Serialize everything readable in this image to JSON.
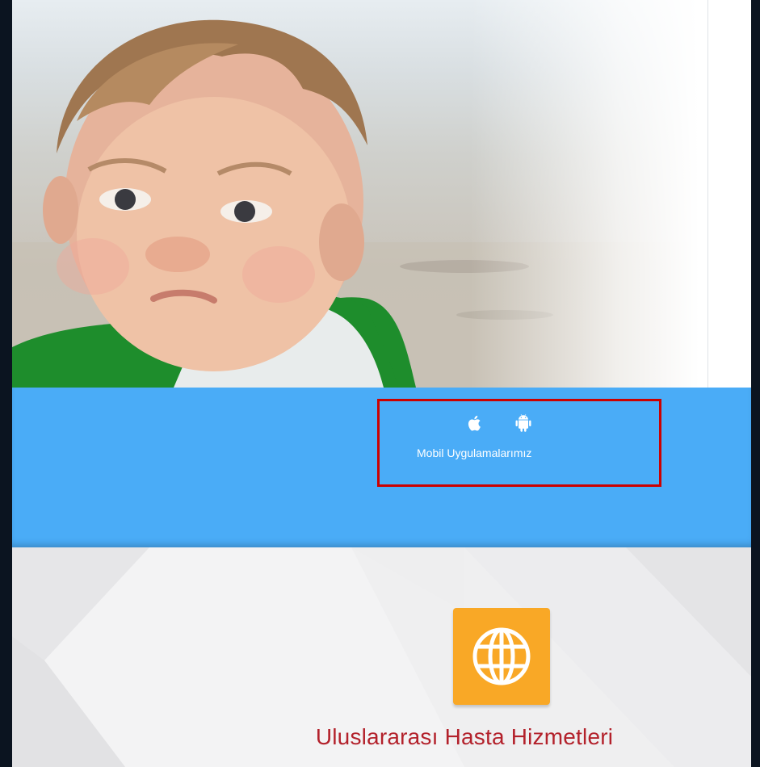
{
  "mobile": {
    "label": "Mobil Uygulamalarımız",
    "icons": [
      "apple-icon",
      "android-icon"
    ]
  },
  "services": {
    "title": "Uluslararası Hasta Hizmetleri",
    "icon": "globe-icon"
  },
  "colors": {
    "band": "#4aacf7",
    "highlight_border": "#cc0000",
    "globe_tile": "#f9a826",
    "title_red": "#b3212b"
  }
}
